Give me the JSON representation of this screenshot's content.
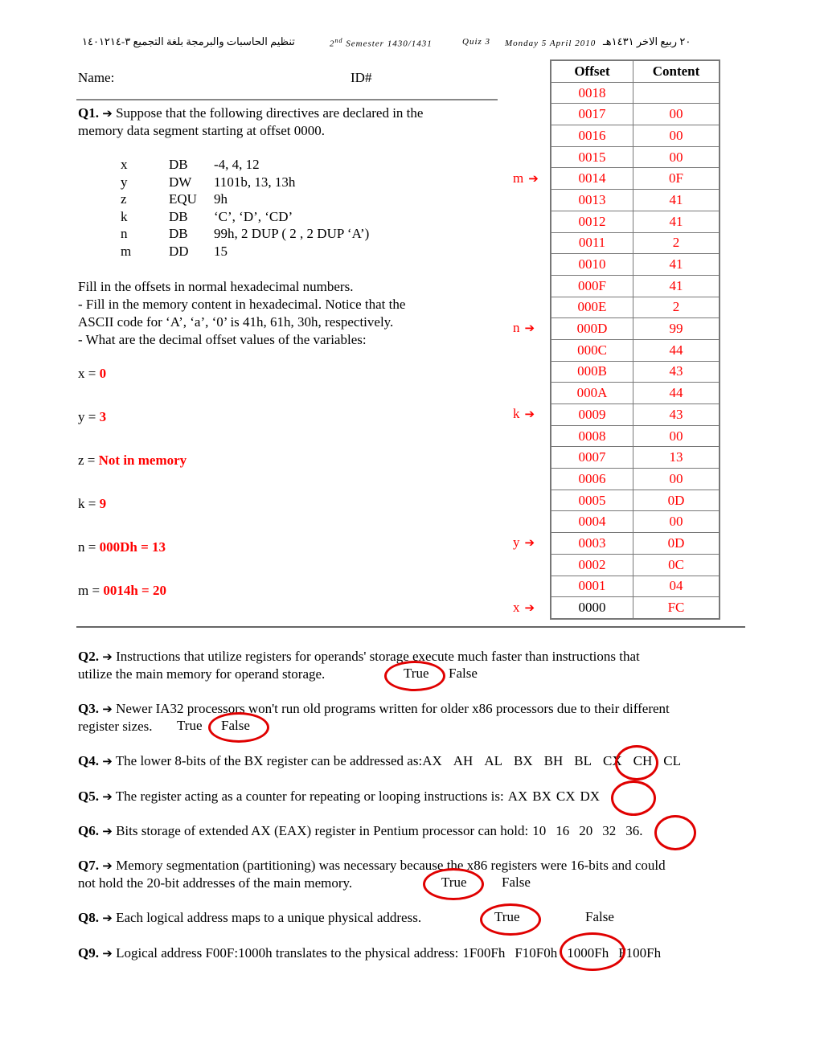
{
  "header": {
    "arabic_right": "٢٠ ربيع الاخر ١٤٣١هـ",
    "date": "Monday 5 April 2010",
    "quiz": "Quiz 3",
    "semester_sup": "nd",
    "semester_num": "2",
    "semester_rest": " Semester 1430/1431",
    "arabic_course": "تنظيم الحاسبات والبرمجة بلغة التجميع ٣-١٤٠١٢١٤"
  },
  "student": {
    "name_label": "Name:",
    "id_label": "ID#"
  },
  "q1": {
    "label": "Q1.",
    "arrow": "➔",
    "text_line1": "Suppose that the following directives are declared in the",
    "text_line2": "memory data segment starting at offset 0000.",
    "directives": [
      {
        "name": "x",
        "type": "DB",
        "value": "-4, 4, 12"
      },
      {
        "name": "y",
        "type": "DW",
        "value": "1101b, 13, 13h"
      },
      {
        "name": "z",
        "type": "EQU",
        "value": "9h"
      },
      {
        "name": "k",
        "type": "DB",
        "value": "‘C’, ‘D’, ‘CD’"
      },
      {
        "name": "n",
        "type": "DB",
        "value": "99h, 2 DUP ( 2 , 2 DUP ‘A’)"
      },
      {
        "name": "m",
        "type": "DD",
        "value": "15"
      }
    ],
    "instr1": "Fill in the offsets in normal hexadecimal numbers.",
    "instr2": "- Fill in the memory content in hexadecimal. Notice that the",
    "instr3": "ASCII code for ‘A’, ‘a’, ‘0’ is 41h, 61h, 30h, respectively.",
    "instr4": "- What are the decimal offset values of the variables:",
    "answers": [
      {
        "var": "x = ",
        "value": "0"
      },
      {
        "var": "y = ",
        "value": "3"
      },
      {
        "var": "z = ",
        "value": "Not in memory"
      },
      {
        "var": "k = ",
        "value": "9"
      },
      {
        "var": "n = ",
        "value": "000Dh = 13"
      },
      {
        "var": "m = ",
        "value": "0014h = 20"
      }
    ]
  },
  "memory_table": {
    "headers": [
      "Offset",
      "Content"
    ],
    "rows": [
      {
        "offset": "0018",
        "content": ""
      },
      {
        "offset": "0017",
        "content": "00"
      },
      {
        "offset": "0016",
        "content": "00"
      },
      {
        "offset": "0015",
        "content": "00"
      },
      {
        "offset": "0014",
        "content": "0F"
      },
      {
        "offset": "0013",
        "content": "41"
      },
      {
        "offset": "0012",
        "content": "41"
      },
      {
        "offset": "0011",
        "content": "2"
      },
      {
        "offset": "0010",
        "content": "41"
      },
      {
        "offset": "000F",
        "content": "41"
      },
      {
        "offset": "000E",
        "content": "2"
      },
      {
        "offset": "000D",
        "content": "99"
      },
      {
        "offset": "000C",
        "content": "44"
      },
      {
        "offset": "000B",
        "content": "43"
      },
      {
        "offset": "000A",
        "content": "44"
      },
      {
        "offset": "0009",
        "content": "43"
      },
      {
        "offset": "0008",
        "content": "00"
      },
      {
        "offset": "0007",
        "content": "13"
      },
      {
        "offset": "0006",
        "content": "00"
      },
      {
        "offset": "0005",
        "content": "0D"
      },
      {
        "offset": "0004",
        "content": "00"
      },
      {
        "offset": "0003",
        "content": "0D"
      },
      {
        "offset": "0002",
        "content": "0C"
      },
      {
        "offset": "0001",
        "content": "04"
      },
      {
        "offset": "0000",
        "content": "FC"
      }
    ],
    "pointers": [
      {
        "label": "m",
        "offset": "0014"
      },
      {
        "label": "n",
        "offset": "000D"
      },
      {
        "label": "k",
        "offset": "0009"
      },
      {
        "label": "y",
        "offset": "0003"
      },
      {
        "label": "x",
        "offset": "0000"
      }
    ],
    "arrow": "➔"
  },
  "questions": {
    "q2": {
      "label": "Q2.",
      "line1": "Instructions that utilize registers for operands' storage execute much faster than instructions that",
      "line2": "utilize the main memory for operand storage.",
      "opt1": "True",
      "opt2": "False",
      "selected": "True"
    },
    "q3": {
      "label": "Q3.",
      "line1": " Newer IA32 processors won't run old programs written for older x86 processors due to their different",
      "line2": "register sizes.",
      "opt1": "True",
      "opt2": "False",
      "selected": "False"
    },
    "q4": {
      "label": "Q4.",
      "text": "The lower 8-bits of the BX register can be addressed as:",
      "options": [
        "AX",
        "AH",
        "AL",
        "BX",
        "BH",
        "BL",
        "CX",
        "CH",
        "CL"
      ],
      "selected": "BL"
    },
    "q5": {
      "label": "Q5.",
      "text": "The  register acting as a counter for repeating or looping instructions is:",
      "options": [
        "AX",
        "BX",
        "CX",
        "DX"
      ],
      "selected": "CX"
    },
    "q6": {
      "label": "Q6.",
      "text": "Bits storage of extended AX (EAX) register in Pentium processor can hold:",
      "options": [
        "10",
        "16",
        "20",
        "32",
        "36."
      ],
      "selected": "32"
    },
    "q7": {
      "label": "Q7.",
      "line1": "Memory segmentation (partitioning) was necessary because the x86 registers were 16-bits and could",
      "line2": "not hold the 20-bit addresses of the main memory.",
      "opt1": "True",
      "opt2": "False",
      "selected": "True"
    },
    "q8": {
      "label": "Q8.",
      "text": "Each logical address maps to a unique physical address.",
      "opt1": "True",
      "opt2": "False",
      "selected": "True"
    },
    "q9": {
      "label": "Q9.",
      "text": "Logical address F00F:1000h translates to the physical address:",
      "options": [
        "1F00Fh",
        "F10F0h",
        "1000Fh",
        "F100Fh"
      ],
      "selected": "F10F0h"
    }
  },
  "colors": {
    "answer": "#ff0000",
    "circle": "#e00000",
    "rule": "#888888"
  }
}
